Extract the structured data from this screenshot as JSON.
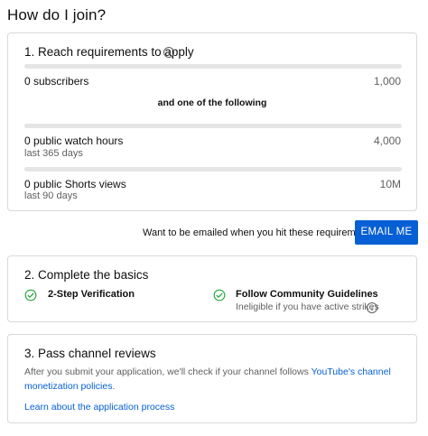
{
  "page": {
    "title": "How do I join?"
  },
  "requirements": {
    "title": "1. Reach requirements to apply",
    "info_icon": "info-icon",
    "subscribers": {
      "label": "0 subscribers",
      "target": "1,000",
      "progress": 0
    },
    "divider": "and one of the following",
    "watch_hours": {
      "label": "0 public watch hours",
      "sublabel": "last 365 days",
      "target": "4,000",
      "progress": 0
    },
    "shorts_views": {
      "label": "0 public Shorts views",
      "sublabel": "last 90 days",
      "target": "10M",
      "progress": 0
    }
  },
  "email": {
    "prompt": "Want to be emailed when you hit these requirements?",
    "button_label": "EMAIL ME"
  },
  "basics": {
    "title": "2. Complete the basics",
    "items": [
      {
        "label": "2-Step Verification",
        "icon": "check-circle-icon"
      },
      {
        "label": "Follow Community Guidelines",
        "sublabel": "Ineligible if you have active strikes",
        "icon": "check-circle-icon"
      }
    ]
  },
  "reviews": {
    "title": "3. Pass channel reviews",
    "text_before": "After you submit your application, we'll check if your channel follows ",
    "link_text": "YouTube's channel monetization policies",
    "text_after": ".",
    "learn_link": "Learn about the application process"
  },
  "colors": {
    "accent": "#065fd4",
    "check": "#2ba640",
    "track": "#e5e5e5"
  }
}
